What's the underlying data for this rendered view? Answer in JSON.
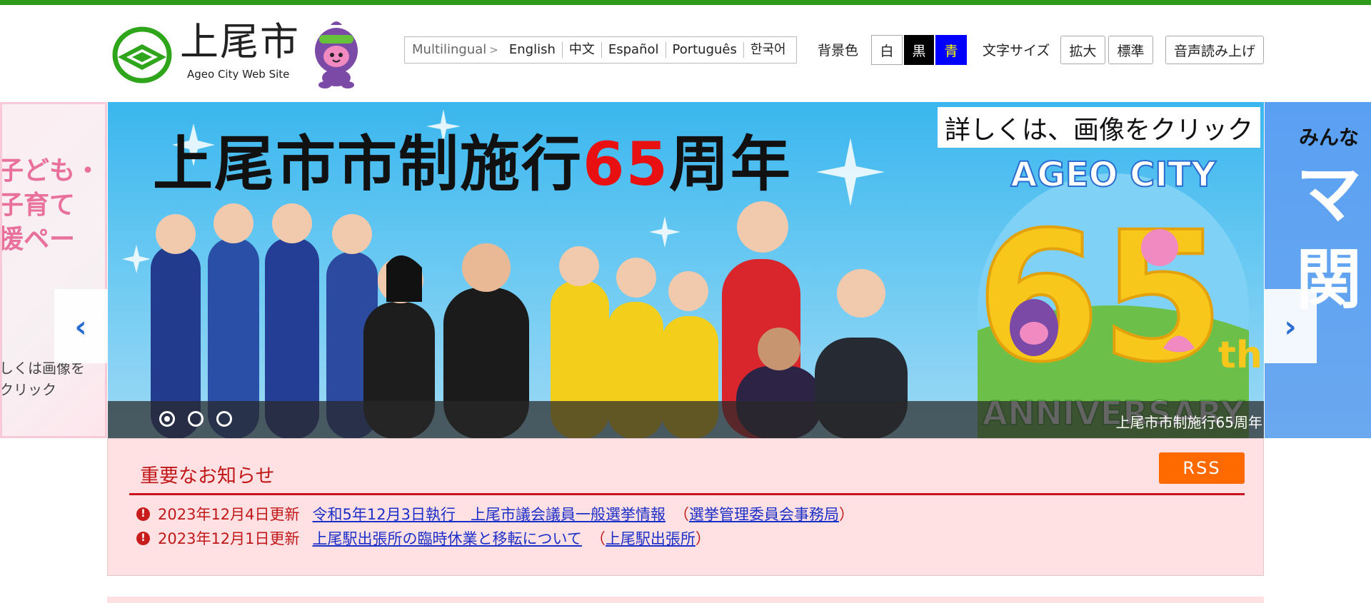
{
  "header": {
    "city_name": "上尾市",
    "site_subtitle": "Ageo City Web Site",
    "languages": {
      "label": "Multilingual",
      "items": [
        "English",
        "中文",
        "Español",
        "Português",
        "한국어"
      ]
    },
    "background_color": {
      "label": "背景色",
      "options": [
        {
          "label": "白",
          "bg": "#ffffff",
          "fg": "#222222"
        },
        {
          "label": "黒",
          "bg": "#000000",
          "fg": "#ffffff"
        },
        {
          "label": "青",
          "bg": "#0000ff",
          "fg": "#ffff00"
        }
      ]
    },
    "text_size": {
      "label": "文字サイズ",
      "enlarge": "拡大",
      "standard": "標準"
    },
    "voice_reading": "音声読み上げ"
  },
  "carousel": {
    "left_slide": {
      "lines": [
        "子ども・",
        "子育て",
        "援ペー"
      ],
      "hint_lines": [
        "しくは画像を",
        "クリック"
      ]
    },
    "main_slide": {
      "title_pre": "上尾市市制施行",
      "title_num": "65",
      "title_post": "周年",
      "detail_link": "詳しくは、画像をクリック",
      "emblem_top": "AGEO CITY",
      "emblem_num": "65",
      "emblem_suffix": "th",
      "emblem_bottom": "ANNIVERSARY",
      "caption": "上尾市市制施行65周年"
    },
    "right_slide": {
      "small_text": "みんな",
      "big_lines": [
        "マ",
        "関"
      ]
    },
    "prev_arrow": "‹",
    "next_arrow": "›",
    "dots": [
      true,
      false,
      false
    ]
  },
  "notices": {
    "title": "重要なお知らせ",
    "rss": "RSS",
    "items": [
      {
        "date": "2023年12月4日更新",
        "link": "令和5年12月3日執行　上尾市議会議員一般選挙情報",
        "dept": "選挙管理委員会事務局"
      },
      {
        "date": "2023年12月1日更新",
        "link": "上尾駅出張所の臨時休業と移転について",
        "dept": "上尾駅出張所"
      }
    ]
  },
  "colors": {
    "brand_green": "#2d9a1a",
    "notice_bg": "#ffe0e3",
    "notice_red": "#c01818",
    "rss_orange": "#ff6a00",
    "link_blue": "#1a2ec8"
  }
}
